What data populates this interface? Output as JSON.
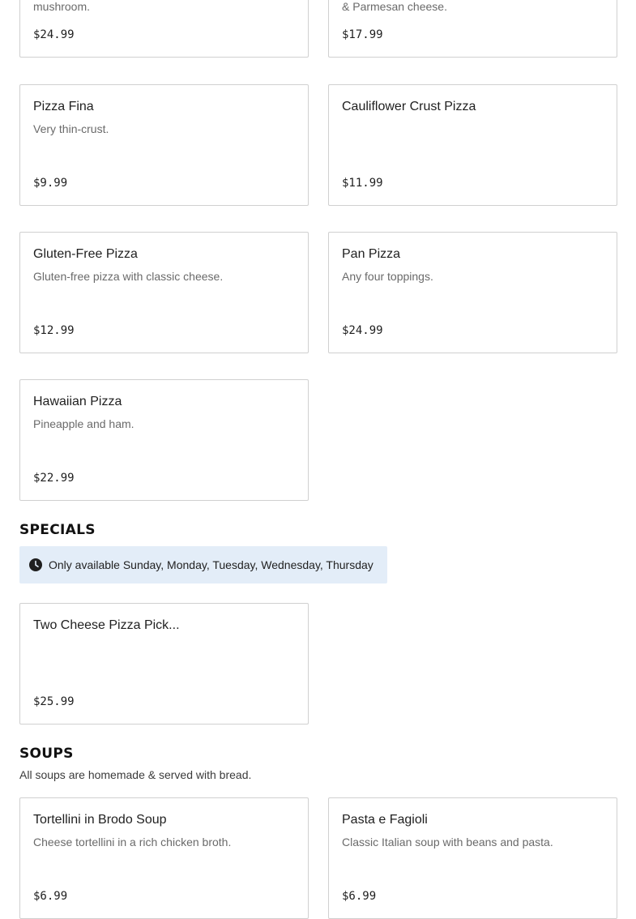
{
  "top_cards": [
    {
      "desc": "mushroom.",
      "price": "$24.99"
    },
    {
      "desc": "& Parmesan cheese.",
      "price": "$17.99"
    }
  ],
  "pizza_cards": [
    {
      "name": "Pizza Fina",
      "desc": "Very thin-crust.",
      "price": "$9.99"
    },
    {
      "name": "Cauliflower Crust Pizza",
      "desc": "",
      "price": "$11.99"
    },
    {
      "name": "Gluten-Free Pizza",
      "desc": "Gluten-free pizza with classic cheese.",
      "price": "$12.99"
    },
    {
      "name": "Pan Pizza",
      "desc": "Any four toppings.",
      "price": "$24.99"
    },
    {
      "name": "Hawaiian Pizza",
      "desc": "Pineapple and ham.",
      "price": "$22.99"
    }
  ],
  "specials": {
    "title": "SPECIALS",
    "availability": "Only available Sunday, Monday, Tuesday, Wednesday, Thursday",
    "icon": "clock-icon",
    "items": [
      {
        "name": "Two Cheese Pizza Pick...",
        "desc": "",
        "price": "$25.99"
      }
    ]
  },
  "soups": {
    "title": "SOUPS",
    "note": "All soups are homemade & served with bread.",
    "items": [
      {
        "name": "Tortellini in Brodo Soup",
        "desc": "Cheese tortellini in a rich chicken broth.",
        "price": "$6.99"
      },
      {
        "name": "Pasta e Fagioli",
        "desc": "Classic Italian soup with beans and pasta.",
        "price": "$6.99"
      }
    ]
  },
  "colors": {
    "card_border": "#d0d0d0",
    "availability_bg": "#e3edf8",
    "description_text": "#6a6a6a"
  }
}
